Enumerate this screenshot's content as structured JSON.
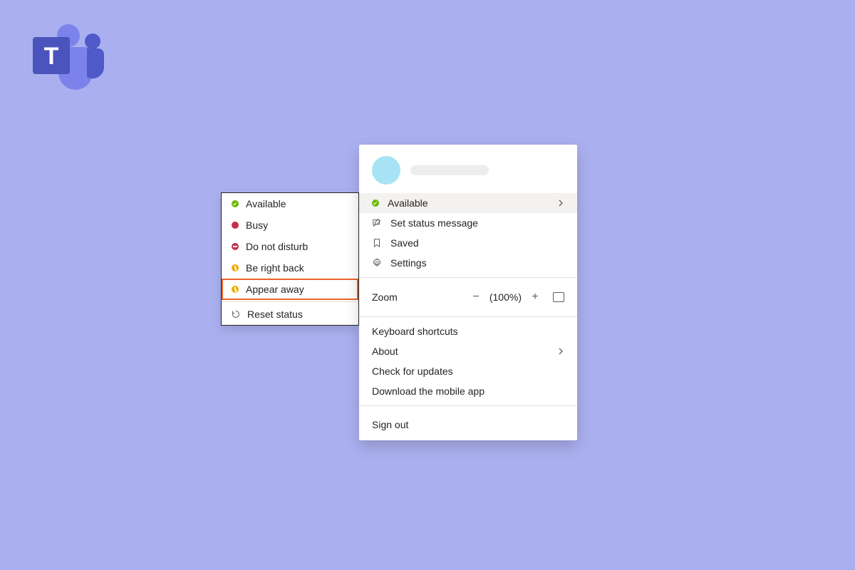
{
  "status_menu": {
    "items": [
      {
        "label": "Available",
        "kind": "available"
      },
      {
        "label": "Busy",
        "kind": "busy"
      },
      {
        "label": "Do not disturb",
        "kind": "dnd"
      },
      {
        "label": "Be right back",
        "kind": "away"
      },
      {
        "label": "Appear away",
        "kind": "away",
        "highlight": true
      }
    ],
    "reset_label": "Reset status"
  },
  "profile_menu": {
    "status_label": "Available",
    "set_status_label": "Set status message",
    "saved_label": "Saved",
    "settings_label": "Settings",
    "zoom_label": "Zoom",
    "zoom_pct": "(100%)",
    "keyboard_label": "Keyboard shortcuts",
    "about_label": "About",
    "updates_label": "Check for updates",
    "download_label": "Download the mobile app",
    "signout_label": "Sign out"
  }
}
